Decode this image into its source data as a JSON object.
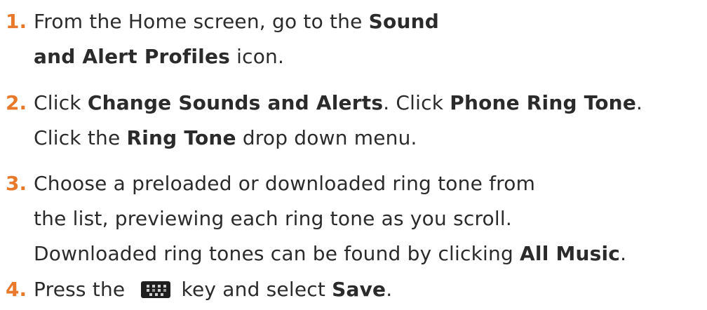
{
  "steps": [
    {
      "number": "1.",
      "lines": [
        [
          "From the Home screen, go to the ",
          "Sound"
        ],
        [
          "and Alert Profiles",
          " icon."
        ]
      ]
    },
    {
      "number": "2.",
      "lines": [
        [
          "Click ",
          "Change Sounds and Alerts",
          ". Click ",
          "Phone Ring Tone",
          "."
        ],
        [
          "Click the ",
          "Ring Tone",
          " drop down menu."
        ]
      ]
    },
    {
      "number": "3.",
      "lines": [
        [
          "Choose a preloaded or downloaded ring tone from"
        ],
        [
          "the list, previewing each ring tone as you scroll."
        ],
        [
          "Downloaded ring tones can be found by clicking ",
          "All Music",
          "."
        ]
      ]
    },
    {
      "number": "4.",
      "lines": [
        [
          "Press the ",
          " key and select ",
          "Save",
          "."
        ]
      ],
      "icon": "blackberry-menu-key-icon"
    }
  ],
  "colors": {
    "number": "#e8782a",
    "text": "#2b2b2b",
    "key": "#1f1f1f"
  }
}
